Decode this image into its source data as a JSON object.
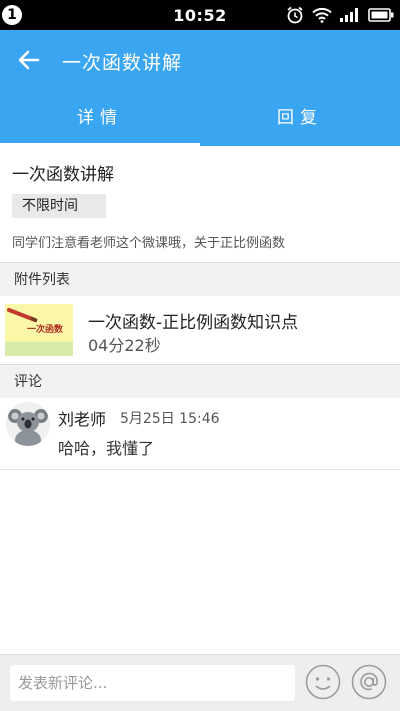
{
  "status_bar": {
    "badge": "1",
    "time": "10:52",
    "icons": [
      "alarm-icon",
      "wifi-icon",
      "signal-icon",
      "battery-icon"
    ]
  },
  "app_bar": {
    "title": "一次函数讲解",
    "back_icon": "arrow-left-icon"
  },
  "tabs": [
    {
      "label": "详情",
      "active": true
    },
    {
      "label": "回复",
      "active": false
    }
  ],
  "detail": {
    "title": "一次函数讲解",
    "time_tag": "不限时间",
    "description": "同学们注意看老师这个微课哦，关于正比例函数"
  },
  "attachments": {
    "header": "附件列表",
    "items": [
      {
        "title": "一次函数-正比例函数知识点",
        "duration": "04分22秒",
        "thumb_text": "一次函数"
      }
    ]
  },
  "comments": {
    "header": "评论",
    "items": [
      {
        "author": "刘老师",
        "time": "5月25日 15:46",
        "text": "哈哈，我懂了"
      }
    ]
  },
  "compose": {
    "placeholder": "发表新评论..."
  },
  "colors": {
    "primary": "#3aa5f0",
    "status_bar": "#000000",
    "section_bg": "#f2f2f2"
  }
}
